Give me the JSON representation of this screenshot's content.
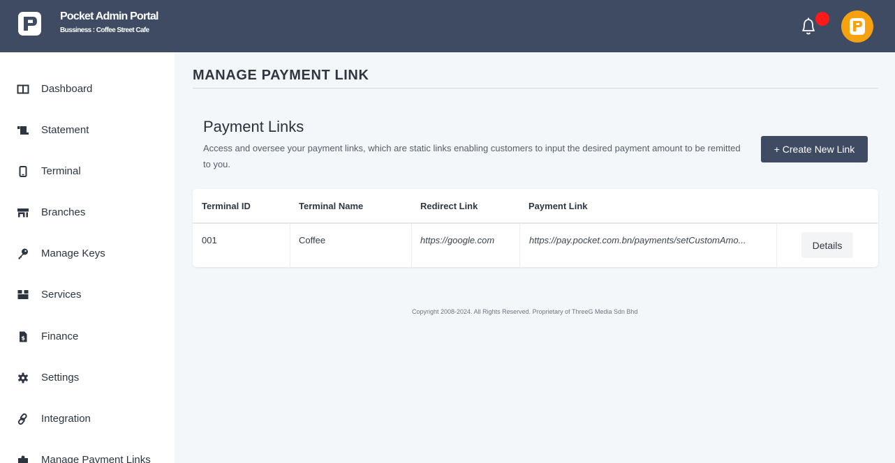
{
  "header": {
    "title": "Pocket Admin Portal",
    "subtitle": "Bussiness : Coffee Street Cafe",
    "notification_icon": "bell-icon",
    "avatar_icon": "pocket-logo-icon",
    "brand_color": "#3f4a63",
    "accent_color": "#f6a20e",
    "alert_color": "#ff1a1a"
  },
  "sidebar": {
    "items": [
      {
        "label": "Dashboard",
        "icon": "columns-icon"
      },
      {
        "label": "Statement",
        "icon": "scroll-icon"
      },
      {
        "label": "Terminal",
        "icon": "mobile-icon"
      },
      {
        "label": "Branches",
        "icon": "store-icon"
      },
      {
        "label": "Manage Keys",
        "icon": "key-icon"
      },
      {
        "label": "Services",
        "icon": "box-icon"
      },
      {
        "label": "Finance",
        "icon": "invoice-icon"
      },
      {
        "label": "Settings",
        "icon": "gear-icon"
      },
      {
        "label": "Integration",
        "icon": "link-icon"
      },
      {
        "label": "Manage Payment Links",
        "icon": "puzzle-icon"
      }
    ]
  },
  "main": {
    "page_title": "MANAGE PAYMENT LINK",
    "section_title": "Payment Links",
    "section_description": "Access and oversee your payment links, which are static links enabling customers to input the desired payment amount to be remitted to you.",
    "create_button": "+ Create New Link",
    "table": {
      "headers": [
        "Terminal ID",
        "Terminal Name",
        "Redirect Link",
        "Payment Link"
      ],
      "rows": [
        {
          "terminal_id": "001",
          "terminal_name": "Coffee",
          "redirect_link": "https://google.com",
          "payment_link": "https://pay.pocket.com.bn/payments/setCustomAmo...",
          "action": "Details"
        }
      ]
    }
  },
  "footer": {
    "copyright": "Copyright 2008-2024. All Rights Reserved. Proprietary of ThreeG Media Sdn Bhd"
  }
}
